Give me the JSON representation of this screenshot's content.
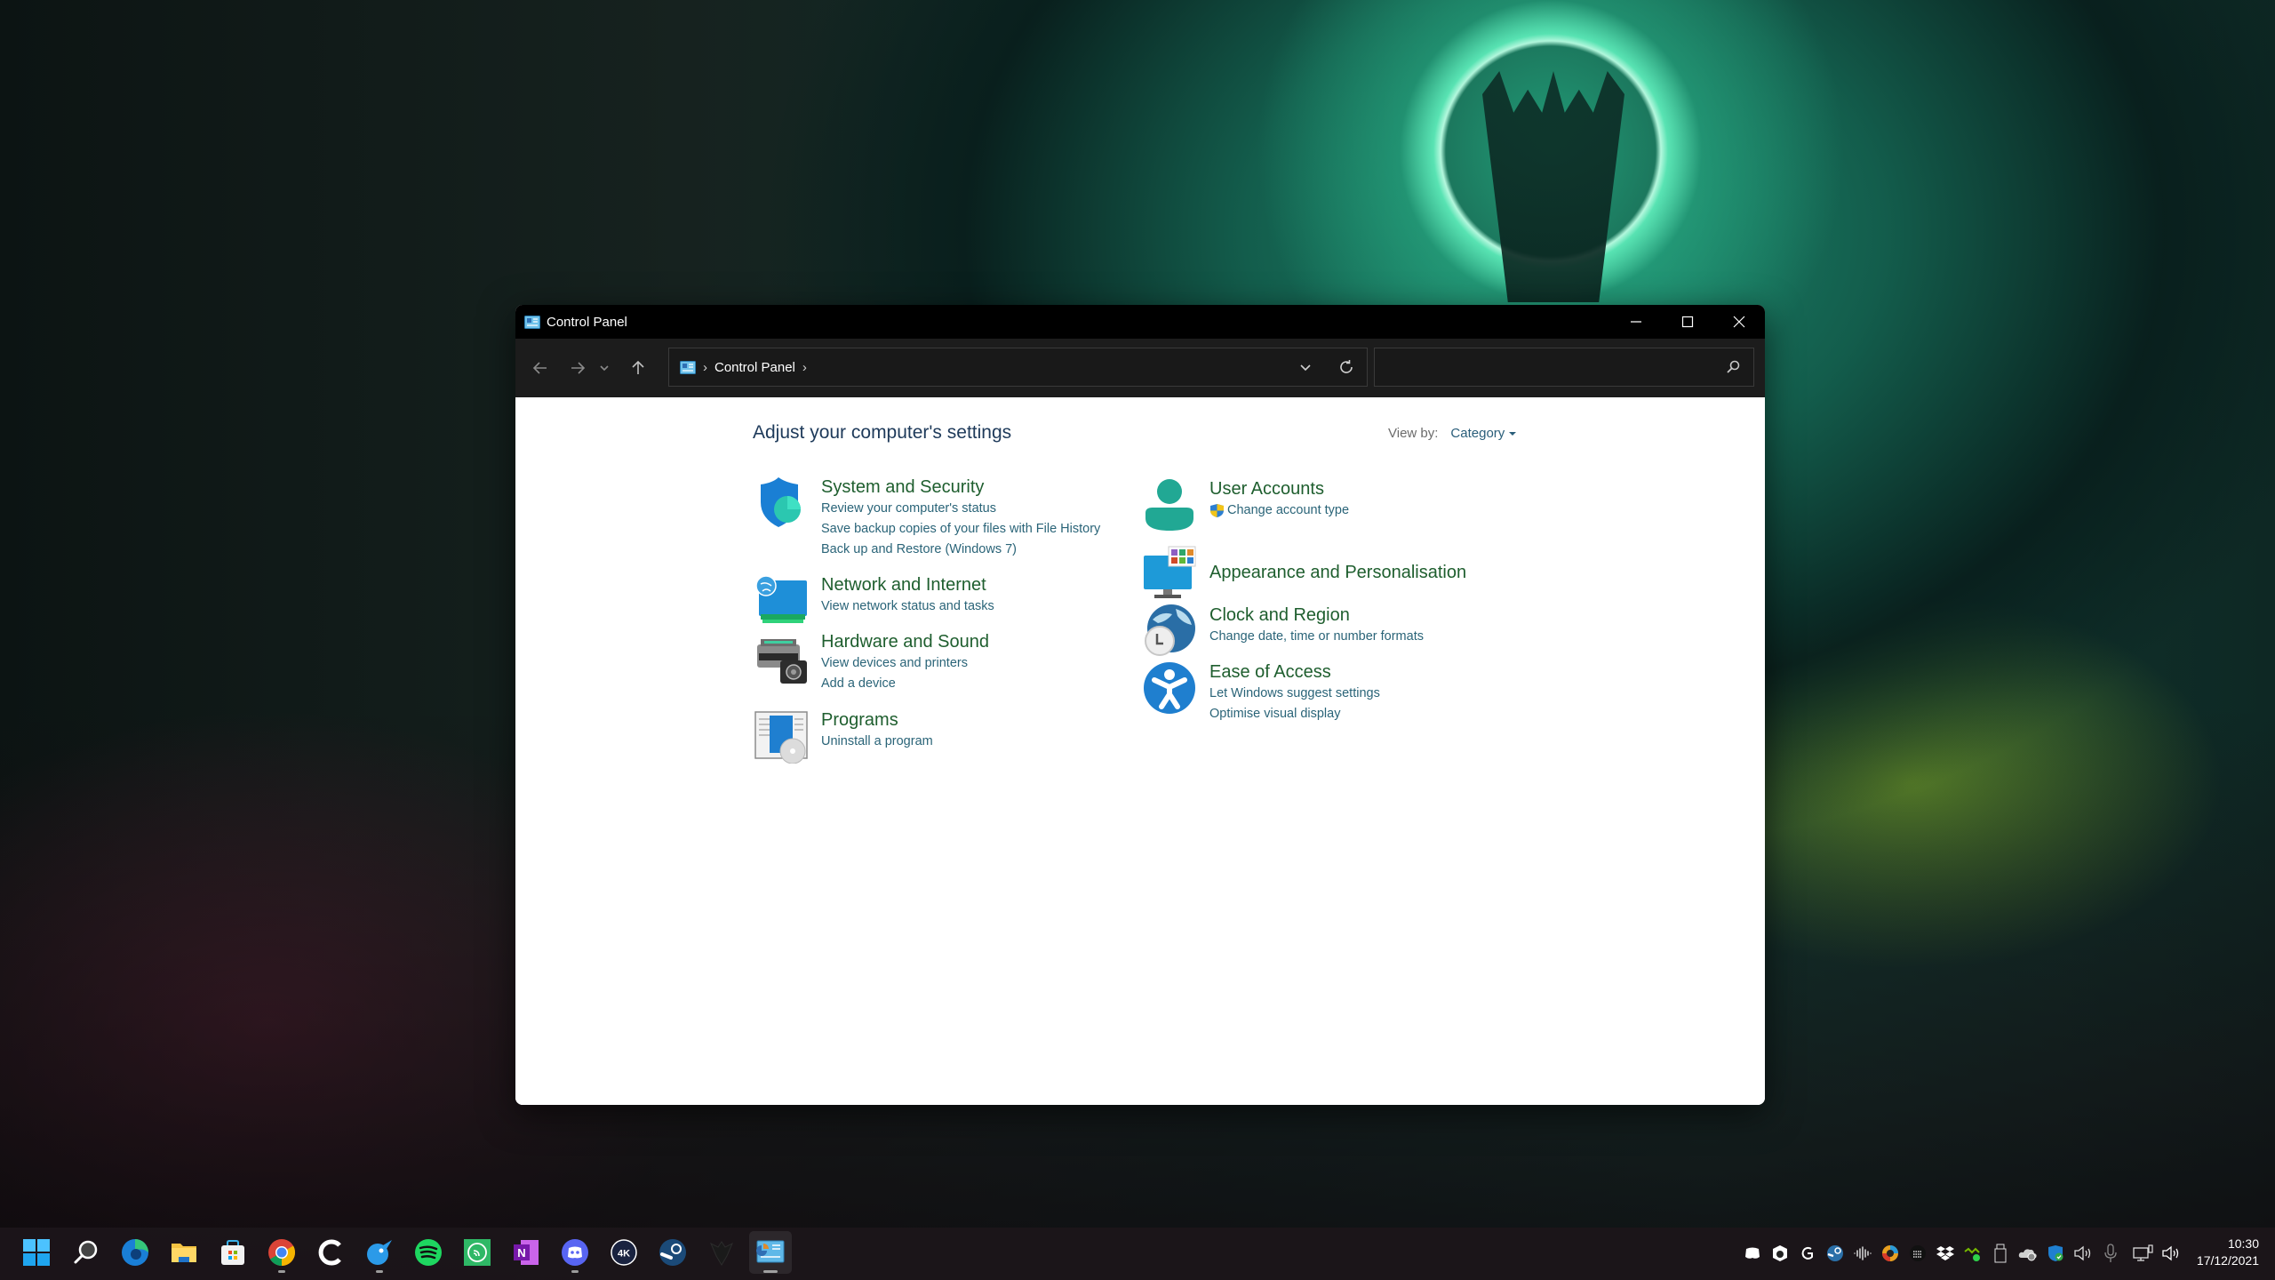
{
  "window": {
    "title": "Control Panel",
    "app_icon": "control-panel-icon",
    "caption_buttons": [
      "minimize",
      "maximize",
      "close"
    ]
  },
  "toolbar": {
    "back_icon": "arrow-left-icon",
    "forward_icon": "arrow-right-icon",
    "recent_icon": "chevron-down-icon",
    "up_icon": "arrow-up-icon",
    "breadcrumb": [
      "Control Panel"
    ],
    "search": {
      "value": "",
      "placeholder": ""
    }
  },
  "content": {
    "heading": "Adjust your computer's settings",
    "view_by": {
      "label": "View by:",
      "selected": "Category"
    },
    "categories": [
      {
        "title": "System and Security",
        "icon": "shield-icon",
        "links": [
          "Review your computer's status",
          "Save backup copies of your files with File History",
          "Back up and Restore (Windows 7)"
        ]
      },
      {
        "title": "Network and Internet",
        "icon": "network-globe-icon",
        "links": [
          "View network status and tasks"
        ]
      },
      {
        "title": "Hardware and Sound",
        "icon": "printer-speaker-icon",
        "links": [
          "View devices and printers",
          "Add a device"
        ]
      },
      {
        "title": "Programs",
        "icon": "programs-disc-icon",
        "links": [
          "Uninstall a program"
        ]
      },
      {
        "title": "User Accounts",
        "icon": "user-icon",
        "links": [
          "Change account type"
        ],
        "link_badge": "uac-shield-icon"
      },
      {
        "title": "Appearance and Personalisation",
        "icon": "monitor-tiles-icon",
        "links": []
      },
      {
        "title": "Clock and Region",
        "icon": "clock-globe-icon",
        "links": [
          "Change date, time or number formats"
        ]
      },
      {
        "title": "Ease of Access",
        "icon": "accessibility-icon",
        "links": [
          "Let Windows suggest settings",
          "Optimise visual display"
        ]
      }
    ]
  },
  "taskbar": {
    "apps": [
      {
        "name": "Start",
        "icon": "windows-start-icon",
        "running": false
      },
      {
        "name": "Search",
        "icon": "search-icon",
        "running": false
      },
      {
        "name": "Microsoft Edge",
        "icon": "edge-icon",
        "running": false
      },
      {
        "name": "File Explorer",
        "icon": "folder-icon",
        "running": false
      },
      {
        "name": "Microsoft Store",
        "icon": "store-icon",
        "running": false
      },
      {
        "name": "Google Chrome",
        "icon": "chrome-icon",
        "running": true
      },
      {
        "name": "CCleaner",
        "icon": "ccleaner-icon",
        "running": false
      },
      {
        "name": "Twitter client",
        "icon": "bird-icon",
        "running": true
      },
      {
        "name": "Spotify",
        "icon": "spotify-icon",
        "running": false
      },
      {
        "name": "Feed reader",
        "icon": "rss-icon",
        "running": false
      },
      {
        "name": "OneNote",
        "icon": "onenote-icon",
        "running": false
      },
      {
        "name": "Discord",
        "icon": "discord-icon",
        "running": true
      },
      {
        "name": "4K Video Downloader",
        "icon": "4k-icon",
        "running": false
      },
      {
        "name": "Steam",
        "icon": "steam-icon",
        "running": false
      },
      {
        "name": "Destiny 2",
        "icon": "destiny-icon",
        "running": false
      },
      {
        "name": "Control Panel",
        "icon": "control-panel-icon",
        "running": true,
        "active": true
      }
    ],
    "onenote_letter": "N",
    "fourk_label": "4K",
    "tray": [
      "discord-tray-icon",
      "antivirus-tray-icon",
      "logitech-tray-icon",
      "steam-tray-icon",
      "audio-wave-tray-icon",
      "color-tray-icon",
      "keyboard-tray-icon",
      "dropbox-tray-icon",
      "nvidia-tray-icon",
      "usb-tray-icon",
      "onedrive-tray-icon",
      "defender-tray-icon",
      "speaker-tray-icon",
      "microphone-tray-icon",
      "network-tray-icon",
      "volume-tray-icon"
    ],
    "clock": {
      "time": "10:30",
      "date": "17/12/2021"
    }
  }
}
